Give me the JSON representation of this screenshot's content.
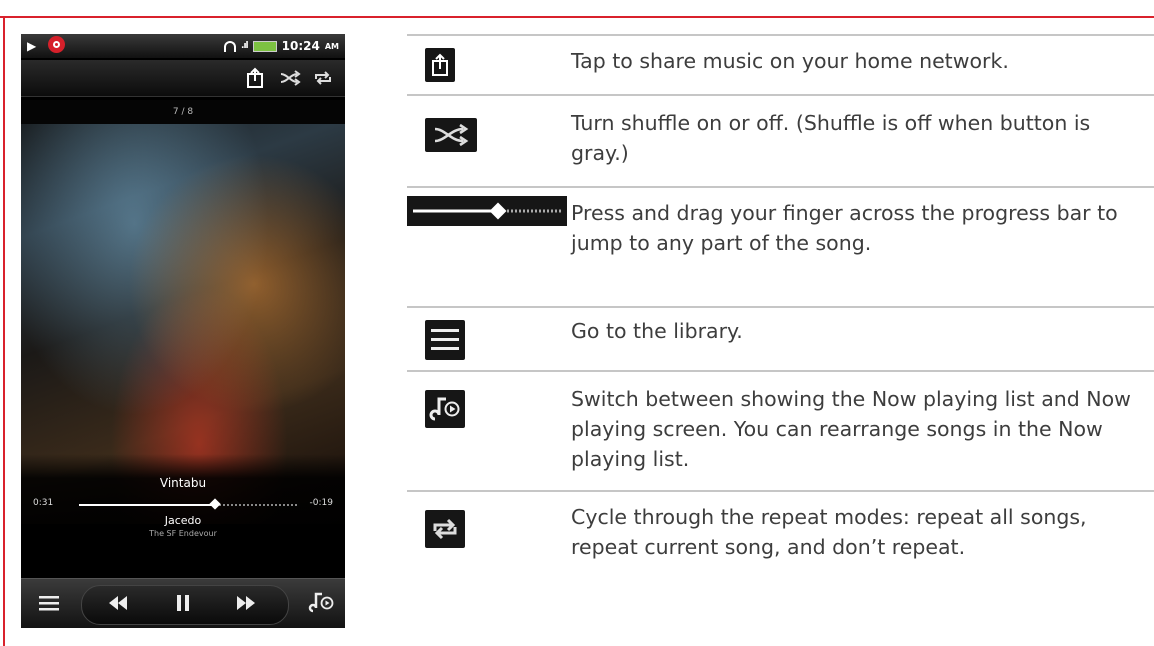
{
  "phone": {
    "status_bar": {
      "time": "10:24",
      "ampm": "AM",
      "signal": ".ıl",
      "icons": [
        "play-icon",
        "beats-audio-icon",
        "headphones-icon",
        "signal-icon",
        "battery-icon"
      ]
    },
    "action_bar": {
      "icons": [
        "share-icon",
        "shuffle-icon",
        "repeat-icon"
      ]
    },
    "track_count": "7 / 8",
    "song_title": "Vintabu",
    "elapsed": "0:31",
    "remaining": "-0:19",
    "progress_fraction": 0.62,
    "artist": "Jacedo",
    "album": "The SF Endevour",
    "controls": {
      "icons": [
        "library-icon",
        "rewind-icon",
        "pause-icon",
        "fast-forward-icon",
        "now-playing-list-icon"
      ]
    }
  },
  "help_table": {
    "rows": [
      {
        "icon": "share-icon",
        "text": "Tap to share music on your home network."
      },
      {
        "icon": "shuffle-icon",
        "text": "Turn shuffle on or off. (Shuffle is off when button is gray.)"
      },
      {
        "icon": "progress-bar-icon",
        "text": "Press and drag your finger across the progress bar to jump to any part of the song."
      },
      {
        "icon": "library-icon",
        "text": "Go to the library."
      },
      {
        "icon": "now-playing-list-icon",
        "text": "Switch between showing the Now playing list and Now playing screen. You can rearrange songs in the Now playing list."
      },
      {
        "icon": "repeat-icon",
        "text": "Cycle through the repeat modes: repeat all songs, repeat current song, and don’t repeat."
      }
    ]
  },
  "colors": {
    "frame": "#d9212c",
    "row_divider": "#c6c6c6",
    "body_text": "#3d3d3d"
  }
}
